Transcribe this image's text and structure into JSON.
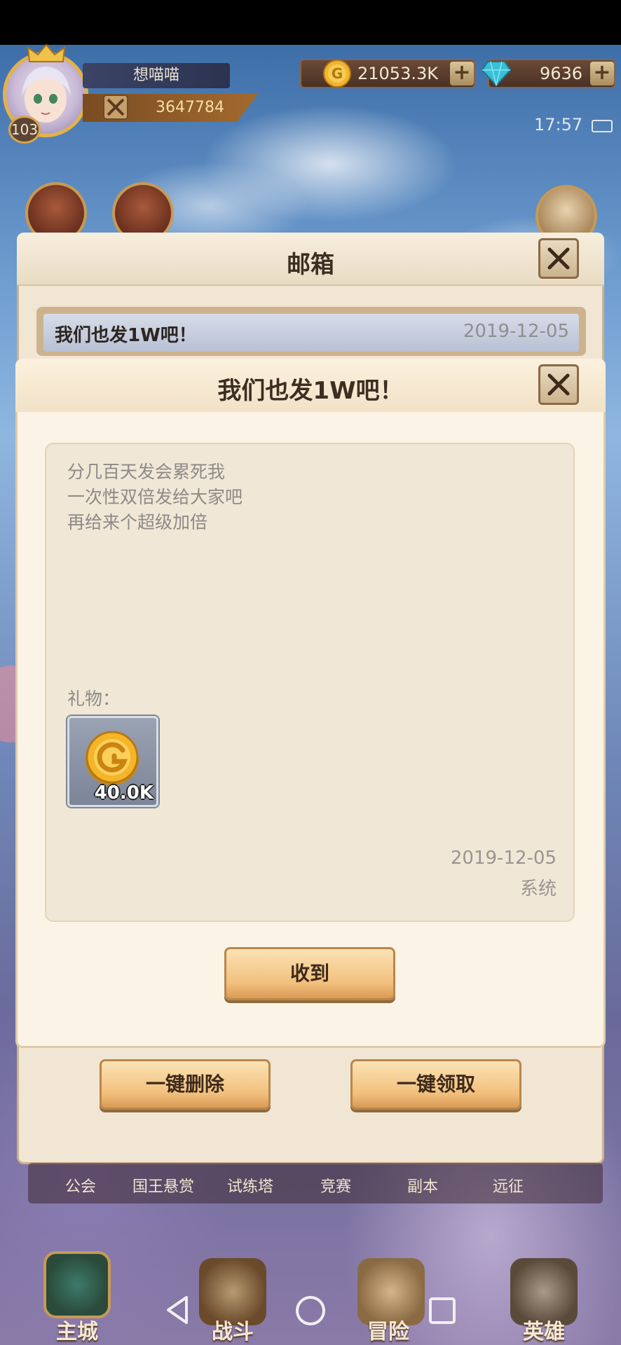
{
  "player": {
    "name": "想喵喵",
    "power": "3647784",
    "level": "103"
  },
  "resources": {
    "gold": "21053.3K",
    "gems": "9636"
  },
  "clock": "17:57",
  "mailbox": {
    "title": "邮箱",
    "items": [
      {
        "subject": "我们也发1W吧！",
        "date": "2019-12-05"
      }
    ],
    "delete_all_label": "一键删除",
    "claim_all_label": "一键领取"
  },
  "mail_detail": {
    "title": "我们也发1W吧！",
    "body_lines": [
      "分几百天发会累死我",
      "一次性双倍发给大家吧",
      "再给来个超级加倍"
    ],
    "gift_label": "礼物：",
    "gift": {
      "icon": "gold-coin-icon",
      "amount": "40.0K"
    },
    "date": "2019-12-05",
    "sender": "系统",
    "receive_label": "收到"
  },
  "feature_nav": [
    "公会",
    "国王悬赏",
    "试练塔",
    "竞赛",
    "副本",
    "远征"
  ],
  "bottom_nav": {
    "main_city": "主城",
    "battle": "战斗",
    "adventure": "冒险",
    "heroes": "英雄"
  },
  "colors": {
    "popup_bg": "#fbf4e6",
    "button_gold": "#f2bf7c",
    "text_gray": "#8d8a86"
  }
}
